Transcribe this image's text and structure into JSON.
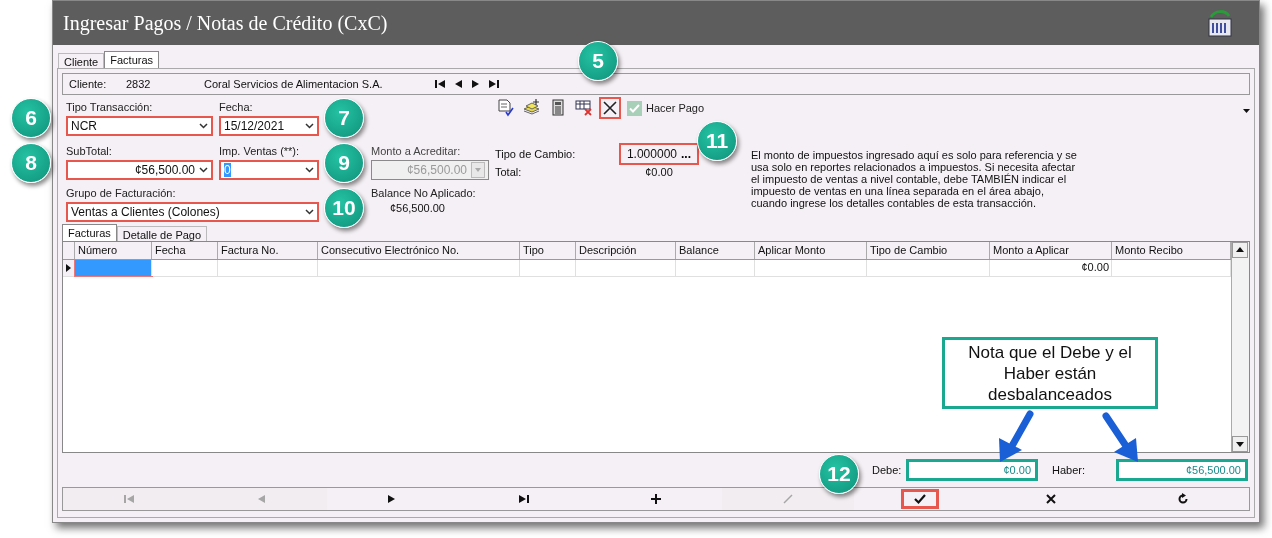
{
  "window": {
    "title": "Ingresar Pagos / Notas de Crédito (CxC)"
  },
  "tabs": [
    {
      "label": "Cliente",
      "selected": false
    },
    {
      "label": "Facturas",
      "selected": true
    }
  ],
  "client": {
    "label": "Cliente:",
    "number": "2832",
    "name": "Coral Servicios de Alimentacion S.A."
  },
  "client_nav": [
    {
      "kind": "first"
    },
    {
      "kind": "prev"
    },
    {
      "kind": "next"
    },
    {
      "kind": "last"
    }
  ],
  "form": {
    "tipo_transaccion": {
      "label": "Tipo Transacción:",
      "value": "NCR",
      "highlight": true
    },
    "fecha": {
      "label": "Fecha:",
      "value": "15/12/2021",
      "highlight": true
    },
    "subtotal": {
      "label": "SubTotal:",
      "value": "¢56,500.00",
      "highlight": true
    },
    "imp_ventas": {
      "label": "Imp. Ventas (**):",
      "value": "0",
      "highlight": true,
      "text_selected": true
    },
    "monto_acreditar": {
      "label": "Monto a Acreditar:",
      "value": "¢56,500.00",
      "highlight": false,
      "disabled": true
    },
    "grupo_facturacion": {
      "label": "Grupo de Facturación:",
      "value": "Ventas a Clientes (Colones)",
      "highlight": true
    },
    "balance_no_aplicado": {
      "label": "Balance No Aplicado:",
      "value": "¢56,500.00"
    },
    "tipo_cambio": {
      "label": "Tipo de Cambio:",
      "value": "1.000000",
      "button": "...",
      "highlight": true
    },
    "total": {
      "label": "Total:",
      "value": "¢0.00"
    },
    "note": "El monto de impuestos ingresado aquí es solo para referencia y se usa solo en reportes relacionados a impuestos. Si necesita afectar el impuesto de ventas a nivel contable, debe TAMBIÉN indicar el impuesto de ventas en una línea separada en el área abajo, cuando ingrese los detalles contables de esta transacción."
  },
  "toolbar": [
    {
      "kind": "edit-check",
      "highlight": false
    },
    {
      "kind": "add-stack",
      "highlight": false
    },
    {
      "kind": "calculator",
      "highlight": false
    },
    {
      "kind": "grid-delete",
      "highlight": false
    },
    {
      "kind": "close",
      "highlight": true
    }
  ],
  "hacer_pago": {
    "label": "Hacer Pago",
    "checked": true
  },
  "detail_tabs": [
    {
      "label": "Facturas",
      "selected": true
    },
    {
      "label": "Detalle de Pago",
      "selected": false
    }
  ],
  "table": {
    "columns": [
      "Número",
      "Fecha",
      "Factura No.",
      "Consecutivo Electrónico No.",
      "Tipo",
      "Descripción",
      "Balance",
      "Aplicar Monto",
      "Tipo de Cambio",
      "Monto a Aplicar",
      "Monto Recibo"
    ],
    "rows": [
      {
        "current": true,
        "cells": [
          {
            "selected": true
          },
          {
            "selected": false
          },
          {
            "selected": false
          },
          {
            "selected": false
          },
          {
            "selected": false
          },
          {
            "selected": false
          },
          {
            "selected": false
          },
          {
            "selected": false
          },
          {
            "selected": false
          },
          {
            "text": "¢0.00",
            "selected": false
          },
          {
            "selected": false
          }
        ]
      }
    ]
  },
  "totals": {
    "debe": {
      "label": "Debe:",
      "value": "¢0.00",
      "highlight": true
    },
    "haber": {
      "label": "Haber:",
      "value": "¢56,500.00",
      "highlight": true
    }
  },
  "nav_buttons": [
    {
      "kind": "first",
      "disabled": true,
      "highlight": false
    },
    {
      "kind": "prev",
      "disabled": true,
      "highlight": false
    },
    {
      "kind": "next",
      "disabled": false,
      "highlight": false
    },
    {
      "kind": "last",
      "disabled": false,
      "highlight": false
    },
    {
      "kind": "add",
      "disabled": false,
      "highlight": false
    },
    {
      "kind": "edit",
      "disabled": true,
      "highlight": false
    },
    {
      "kind": "save",
      "disabled": false,
      "highlight": true
    },
    {
      "kind": "cancel",
      "disabled": false,
      "highlight": false
    },
    {
      "kind": "refresh",
      "disabled": false,
      "highlight": false
    }
  ],
  "annotations": {
    "badges": [
      "5",
      "6",
      "7",
      "8",
      "9",
      "10",
      "11",
      "12"
    ],
    "note": "Nota que el Debe y el Haber están desbalanceados"
  }
}
